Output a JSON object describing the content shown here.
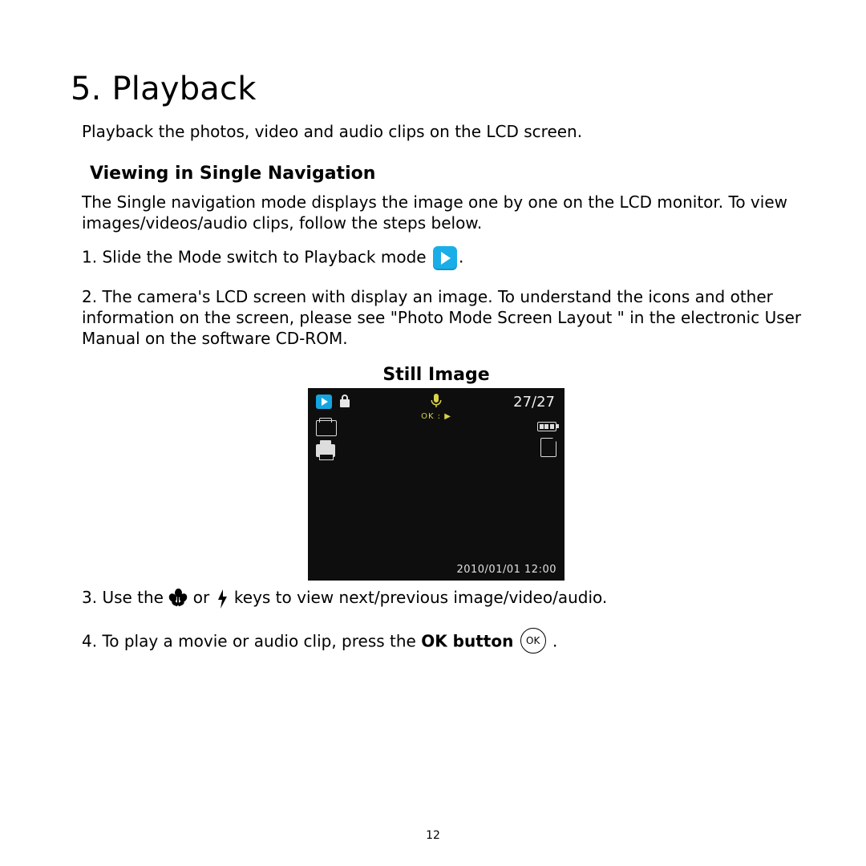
{
  "chapter_title": "5. Playback",
  "intro": "Playback the photos, video and audio clips on the LCD screen.",
  "section_title": "Viewing in Single Navigation",
  "section_intro": "The Single navigation mode displays the image one by one on the LCD monitor.  To view images/videos/audio clips, follow the steps below.",
  "steps": {
    "s1_pre": "1.  Slide the Mode switch to Playback mode ",
    "s1_post": ".",
    "s2": "2.  The camera's LCD screen with display an image. To understand the icons and other information on the screen, please see \"Photo Mode Screen Layout \" in the electronic User Manual on the software CD-ROM.",
    "s3_pre": "3.  Use the ",
    "s3_mid": " or ",
    "s3_post": " keys to view next/previous image/video/audio.",
    "s4_pre": "4.  To play a movie or audio clip, press the ",
    "s4_bold": "OK button",
    "s4_post": " ."
  },
  "still_image_title": "Still Image",
  "ok_label": "OK",
  "lcd": {
    "counter": "27/27",
    "ok_play": "OK : ▶",
    "timestamp": "2010/01/01 12:00"
  },
  "page_number": "12"
}
